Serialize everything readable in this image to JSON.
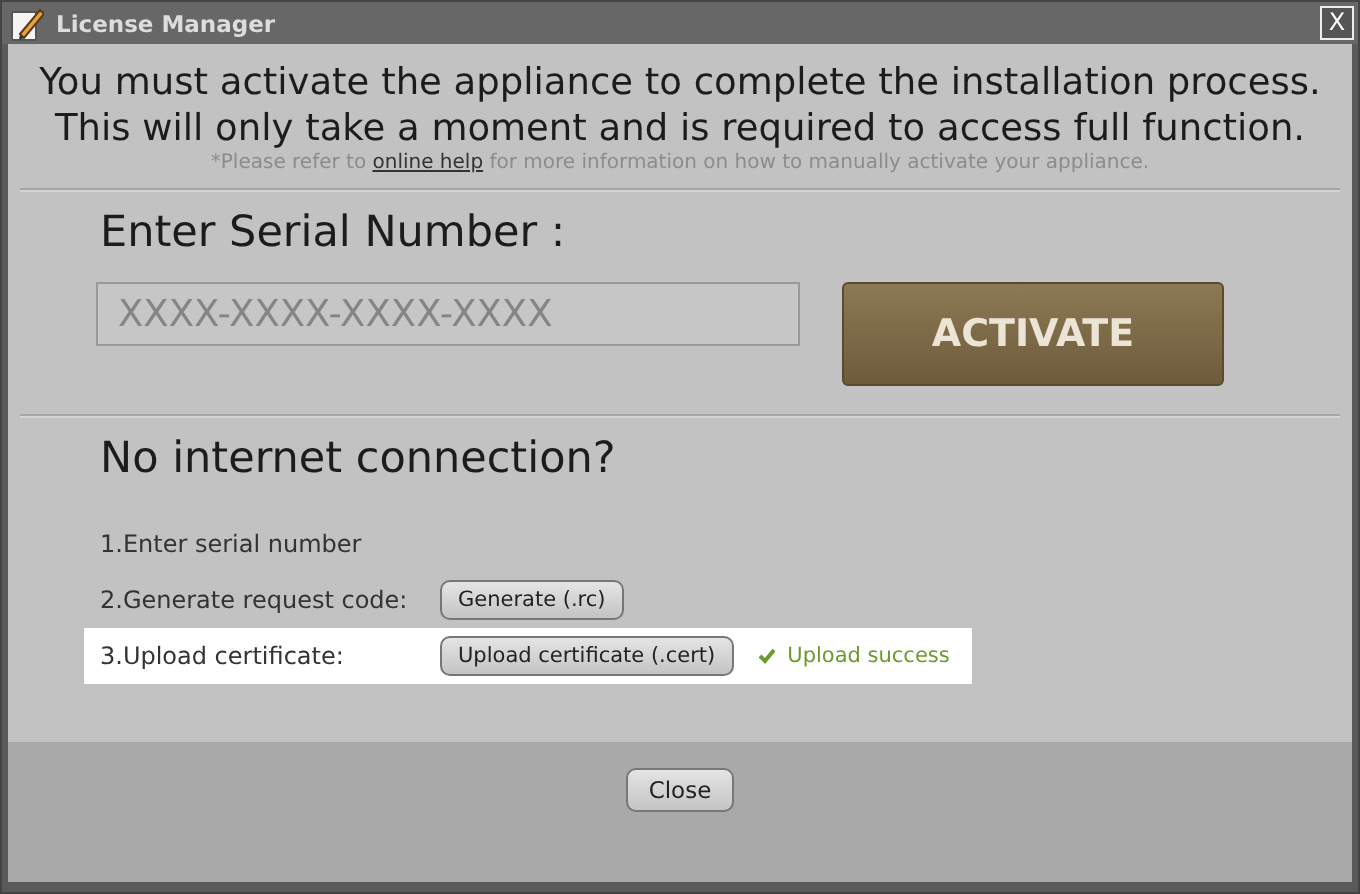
{
  "window": {
    "title": "License Manager",
    "close_glyph": "X"
  },
  "intro": [
    "You must activate the appliance to complete the installation process.",
    "This will only take a moment and is required to access full function."
  ],
  "note": {
    "before": "*Please refer to ",
    "link": "online help",
    "after": " for more information on how to manually activate your appliance."
  },
  "serial": {
    "heading": "Enter Serial Number :",
    "placeholder": "XXXX-XXXX-XXXX-XXXX",
    "button": "ACTIVATE"
  },
  "offline": {
    "heading": "No internet connection?",
    "steps": [
      {
        "kind": "text",
        "label": "1.Enter serial number",
        "highlighted": false
      },
      {
        "kind": "button",
        "label": "2.Generate request code:",
        "button": "Generate (.rc)",
        "highlighted": false
      },
      {
        "kind": "button",
        "label": "3.Upload certificate:",
        "button": "Upload certificate (.cert)",
        "highlighted": true,
        "status": "Upload success"
      }
    ]
  },
  "footer": {
    "button": "Close"
  }
}
